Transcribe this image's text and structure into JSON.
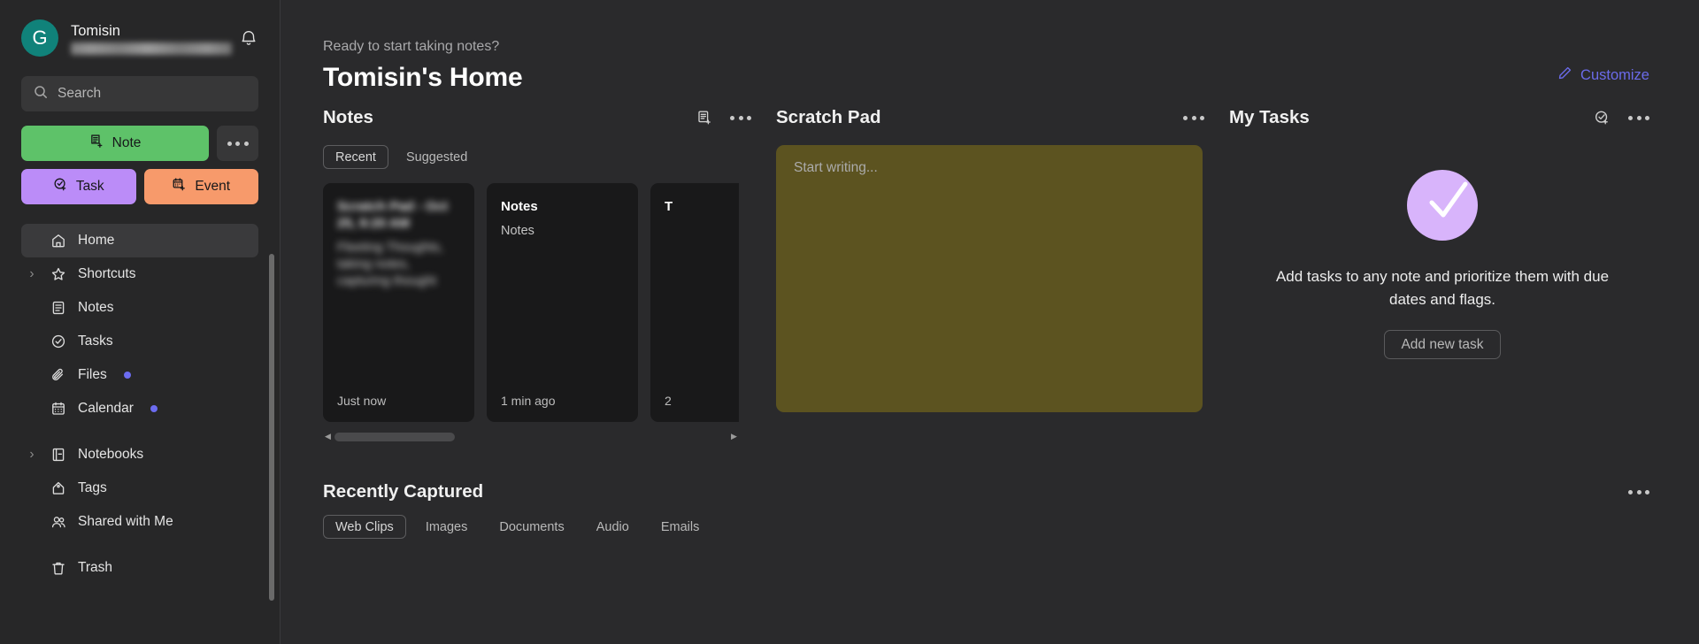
{
  "sidebar": {
    "account": {
      "avatar_initial": "G",
      "name": "Tomisin",
      "email_redacted": true,
      "bell_icon": "bell-icon"
    },
    "search": {
      "placeholder": "Search",
      "value": "",
      "icon": "search-icon"
    },
    "actions": {
      "note_label": "Note",
      "note_color": "#5ec269",
      "task_label": "Task",
      "task_color": "#bb8cf8",
      "event_label": "Event",
      "event_color": "#f79a6b",
      "more_icon": "ellipsis-icon"
    },
    "items": [
      {
        "label": "Home",
        "icon": "home-icon",
        "caret": false,
        "active": true,
        "dot": false
      },
      {
        "label": "Shortcuts",
        "icon": "star-icon",
        "caret": true,
        "active": false,
        "dot": false
      },
      {
        "label": "Notes",
        "icon": "note-icon",
        "caret": false,
        "active": false,
        "dot": false
      },
      {
        "label": "Tasks",
        "icon": "check-circle-icon",
        "caret": false,
        "active": false,
        "dot": false
      },
      {
        "label": "Files",
        "icon": "paperclip-icon",
        "caret": false,
        "active": false,
        "dot": true
      },
      {
        "label": "Calendar",
        "icon": "calendar-icon",
        "caret": false,
        "active": false,
        "dot": true
      }
    ],
    "items2": [
      {
        "label": "Notebooks",
        "icon": "notebook-icon",
        "caret": true,
        "active": false,
        "dot": false
      },
      {
        "label": "Tags",
        "icon": "tag-icon",
        "caret": false,
        "active": false,
        "dot": false
      },
      {
        "label": "Shared with Me",
        "icon": "people-icon",
        "caret": false,
        "active": false,
        "dot": false
      }
    ],
    "items3": [
      {
        "label": "Trash",
        "icon": "trash-icon",
        "caret": false,
        "active": false,
        "dot": false
      }
    ]
  },
  "header": {
    "eyebrow": "Ready to start taking notes?",
    "title": "Tomisin's Home",
    "customize_label": "Customize",
    "customize_color": "#6b6bea",
    "customize_icon": "pencil-icon"
  },
  "notes_panel": {
    "title": "Notes",
    "new_note_icon": "new-note-icon",
    "more_icon": "ellipsis-icon",
    "tabs": [
      {
        "label": "Recent",
        "active": true
      },
      {
        "label": "Suggested",
        "active": false
      }
    ],
    "cards": [
      {
        "title": "Scratch Pad - Oct 25, 9:20 AM",
        "body": "Fleeting Thoughts, taking notes, capturing thought",
        "time": "Just now",
        "blurred": true
      },
      {
        "title": "Notes",
        "body": "Notes",
        "time": "1 min ago",
        "blurred": false
      },
      {
        "title": "T",
        "body": "",
        "time": "2",
        "blurred": false
      }
    ]
  },
  "scratch_pad": {
    "title": "Scratch Pad",
    "more_icon": "ellipsis-icon",
    "placeholder": "Start writing...",
    "value": "",
    "bg_color": "#5c5320"
  },
  "my_tasks": {
    "title": "My Tasks",
    "add_task_icon": "add-task-icon",
    "more_icon": "ellipsis-icon",
    "empty_illustration": "check-circle-illustration",
    "empty_color": "#d8b4fb",
    "empty_message": "Add tasks to any note and prioritize them with due dates and flags.",
    "add_new_task_label": "Add new task"
  },
  "recently_captured": {
    "title": "Recently Captured",
    "more_icon": "ellipsis-icon",
    "tabs": [
      {
        "label": "Web Clips",
        "active": true
      },
      {
        "label": "Images",
        "active": false
      },
      {
        "label": "Documents",
        "active": false
      },
      {
        "label": "Audio",
        "active": false
      },
      {
        "label": "Emails",
        "active": false
      }
    ]
  }
}
